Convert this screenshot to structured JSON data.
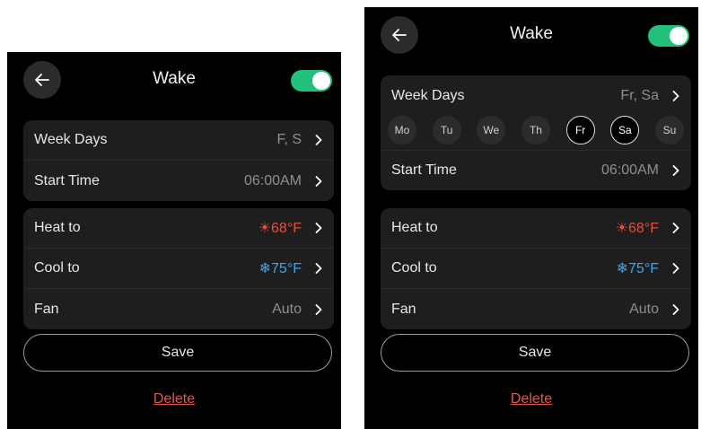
{
  "left": {
    "title": "Wake",
    "toggle_on": true,
    "schedule": [
      {
        "label": "Week Days",
        "value": "F, S"
      },
      {
        "label": "Start Time",
        "value": "06:00AM"
      }
    ],
    "climate": [
      {
        "label": "Heat to",
        "value": "68°F"
      },
      {
        "label": "Cool to",
        "value": "75°F"
      },
      {
        "label": "Fan",
        "value": "Auto"
      }
    ],
    "save_label": "Save",
    "delete_label": "Delete"
  },
  "right": {
    "title": "Wake",
    "toggle_on": true,
    "week_days": {
      "label": "Week Days",
      "value": "Fr, Sa"
    },
    "days": [
      {
        "label": "Mo",
        "selected": false
      },
      {
        "label": "Tu",
        "selected": false
      },
      {
        "label": "We",
        "selected": false
      },
      {
        "label": "Th",
        "selected": false
      },
      {
        "label": "Fr",
        "selected": true
      },
      {
        "label": "Sa",
        "selected": true
      },
      {
        "label": "Su",
        "selected": false
      }
    ],
    "start_time": {
      "label": "Start Time",
      "value": "06:00AM"
    },
    "climate": [
      {
        "label": "Heat to",
        "value": "68°F"
      },
      {
        "label": "Cool to",
        "value": "75°F"
      },
      {
        "label": "Fan",
        "value": "Auto"
      }
    ],
    "save_label": "Save",
    "delete_label": "Delete"
  },
  "colors": {
    "toggle_on": "#22c07a",
    "heat": "#e74c3c",
    "cool": "#3fa6e8",
    "delete": "#e0574f"
  },
  "icons": {
    "back": "arrow-left-icon",
    "chevron": "chevron-right-icon",
    "heat": "sun-icon",
    "cool": "snowflake-icon"
  }
}
